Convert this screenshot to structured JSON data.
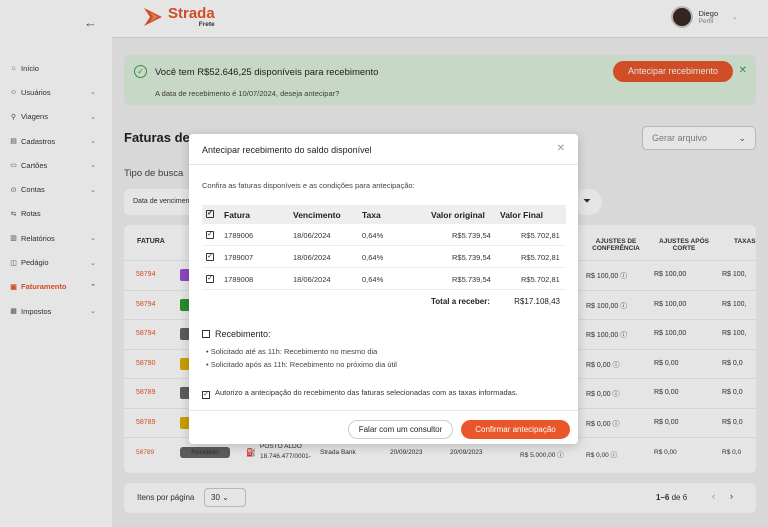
{
  "brand": {
    "name": "Strada",
    "sub": "Frete",
    "color": "#e8562a"
  },
  "user": {
    "name": "Diego",
    "role": "Perfil"
  },
  "sidebar": {
    "items": [
      {
        "label": "Início",
        "icon": "home-icon",
        "glyph": "⌂",
        "active": false,
        "chevron": ""
      },
      {
        "label": "Usuários",
        "icon": "users-icon",
        "glyph": "☺",
        "active": false,
        "chevron": "⌄"
      },
      {
        "label": "Viagens",
        "icon": "map-icon",
        "glyph": "⚲",
        "active": false,
        "chevron": "⌄"
      },
      {
        "label": "Cadastros",
        "icon": "clipboard-icon",
        "glyph": "▤",
        "active": false,
        "chevron": "⌄"
      },
      {
        "label": "Cartões",
        "icon": "card-icon",
        "glyph": "▭",
        "active": false,
        "chevron": "⌄"
      },
      {
        "label": "Contas",
        "icon": "bank-icon",
        "glyph": "⊙",
        "active": false,
        "chevron": "⌄"
      },
      {
        "label": "Rotas",
        "icon": "route-icon",
        "glyph": "⇆",
        "active": false,
        "chevron": ""
      },
      {
        "label": "Relatórios",
        "icon": "chart-icon",
        "glyph": "▥",
        "active": false,
        "chevron": "⌄"
      },
      {
        "label": "Pedágio",
        "icon": "toll-icon",
        "glyph": "◫",
        "active": false,
        "chevron": "⌄"
      },
      {
        "label": "Faturamento",
        "icon": "invoice-icon",
        "glyph": "▣",
        "active": true,
        "chevron": "⌃"
      },
      {
        "label": "Impostos",
        "icon": "tax-icon",
        "glyph": "▦",
        "active": false,
        "chevron": "⌄"
      }
    ]
  },
  "banner": {
    "message": "Você tem R$52.646,25 disponíveis para recebimento",
    "question": "A data de recebimento é 10/07/2024, deseja antecipar?",
    "button": "Antecipar recebimento"
  },
  "page": {
    "title": "Faturas de",
    "gerar": "Gerar arquivo",
    "tipo_busca": "Tipo de busca",
    "select_value": "Data de vencimen"
  },
  "table": {
    "headers": {
      "fatura": "FATURA",
      "ajustes_conf": "AJUSTES DE CONFERÊNCIA",
      "ajustes_corte": "AJUSTES APÓS CORTE",
      "taxas": "TAXAS"
    },
    "rows": [
      {
        "id": "58794",
        "tag": "#9a50d8",
        "c1": "R$   100,00 ⓘ",
        "c2": "R$   100,00",
        "c3": "R$  100,"
      },
      {
        "id": "58794",
        "tag": "#2f9a35",
        "c1": "R$   100,00 ⓘ",
        "c2": "R$   100,00",
        "c3": "R$  100,"
      },
      {
        "id": "58794",
        "tag": "#666666",
        "c1": "R$   100,00 ⓘ",
        "c2": "R$   100,00",
        "c3": "R$  100,"
      },
      {
        "id": "58790",
        "tag": "#e0b000",
        "c1": "R$      0,00 ⓘ",
        "c2": "R$       0,00",
        "c3": "R$     0,0"
      },
      {
        "id": "58789",
        "tag": "#666666",
        "c1": "R$      0,00 ⓘ",
        "c2": "R$       0,00",
        "c3": "R$     0,0"
      },
      {
        "id": "58789",
        "tag": "#e0b000",
        "c1": "R$      0,00 ⓘ",
        "c2": "R$       0,00",
        "c3": "R$     0,0"
      }
    ],
    "last_row": {
      "id": "58789",
      "status": "Recebido",
      "posto": "POSTO ALDO",
      "cnpj": "18.746.477/0001-",
      "bank": "Strada Bank",
      "d1": "20/09/2023",
      "d2": "20/09/2023",
      "valor": "R$   5.000,00 ⓘ",
      "c1": "R$      0,00 ⓘ",
      "c2": "R$       0,00",
      "c3": "R$     0,0"
    }
  },
  "pager": {
    "label": "Itens por página",
    "size": "30",
    "range": "1–6",
    "of": "de 6"
  },
  "modal": {
    "title": "Antecipar recebimento do saldo disponível",
    "subtitle": "Confira as faturas disponíveis e as condições para antecipação:",
    "headers": {
      "fatura": "Fatura",
      "venc": "Vencimento",
      "taxa": "Taxa",
      "orig": "Valor original",
      "final": "Valor Final"
    },
    "rows": [
      {
        "fatura": "1789006",
        "venc": "18/06/2024",
        "taxa": "0,64%",
        "orig": "R$5.739,54",
        "final": "R$5.702,81"
      },
      {
        "fatura": "1789007",
        "venc": "18/06/2024",
        "taxa": "0,64%",
        "orig": "R$5.739,54",
        "final": "R$5.702,81"
      },
      {
        "fatura": "1789008",
        "venc": "18/06/2024",
        "taxa": "0,64%",
        "orig": "R$5.739,54",
        "final": "R$5.702,81"
      }
    ],
    "total_label": "Total a receber:",
    "total_value": "R$17.108,43",
    "receb_title": "Recebimento:",
    "bullet1": "•  Solicitado até as 11h: Recebimento no mesmo dia",
    "bullet2": "•  Solicitado após as 11h: Recebimento no próximo dia útil",
    "authorize": "Autorizo a antecipação do recebimento das faturas selecionadas com as taxas informadas.",
    "btn_consultor": "Falar com um consultor",
    "btn_confirm": "Confirmar antecipação"
  }
}
